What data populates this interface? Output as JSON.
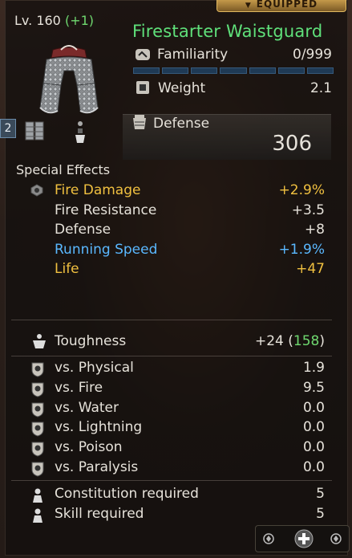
{
  "header": {
    "equipped_label": "EQUIPPED",
    "level_prefix": "Lv. 160",
    "level_bonus": "(+1)",
    "item_name": "Firestarter Waistguard",
    "tier_badge": "2"
  },
  "stats": {
    "familiarity_label": "Familiarity",
    "familiarity_value": "0/999",
    "familiarity_fill": 0,
    "weight_label": "Weight",
    "weight_value": "2.1",
    "defense_label": "Defense",
    "defense_value": "306"
  },
  "special_effects": {
    "title": "Special Effects",
    "items": [
      {
        "label": "Fire Damage",
        "value": "+2.9%",
        "color": "#f0c040"
      },
      {
        "label": "Fire Resistance",
        "value": "+3.5",
        "color": "#e6e2da"
      },
      {
        "label": "Defense",
        "value": "+8",
        "color": "#e6e2da"
      },
      {
        "label": "Running Speed",
        "value": "+1.9%",
        "color": "#5ab8ff"
      },
      {
        "label": "Life",
        "value": "+47",
        "color": "#f0c040"
      }
    ]
  },
  "toughness": {
    "label": "Toughness",
    "value": "+24",
    "total": "158",
    "total_open": "(",
    "total_close": ")"
  },
  "resistances": [
    {
      "label": "vs. Physical",
      "value": "1.9",
      "icon": "physical-resist-icon"
    },
    {
      "label": "vs. Fire",
      "value": "9.5",
      "icon": "fire-resist-icon"
    },
    {
      "label": "vs. Water",
      "value": "0.0",
      "icon": "water-resist-icon"
    },
    {
      "label": "vs. Lightning",
      "value": "0.0",
      "icon": "lightning-resist-icon"
    },
    {
      "label": "vs. Poison",
      "value": "0.0",
      "icon": "poison-resist-icon"
    },
    {
      "label": "vs. Paralysis",
      "value": "0.0",
      "icon": "paralysis-resist-icon"
    }
  ],
  "requirements": [
    {
      "label": "Constitution required",
      "value": "5",
      "icon": "constitution-icon"
    },
    {
      "label": "Skill required",
      "value": "5",
      "icon": "skill-icon"
    }
  ],
  "colors": {
    "name_green": "#5fe07a",
    "gold": "#f0c040",
    "blue": "#5ab8ff",
    "bonus_green": "#6fd86f"
  }
}
